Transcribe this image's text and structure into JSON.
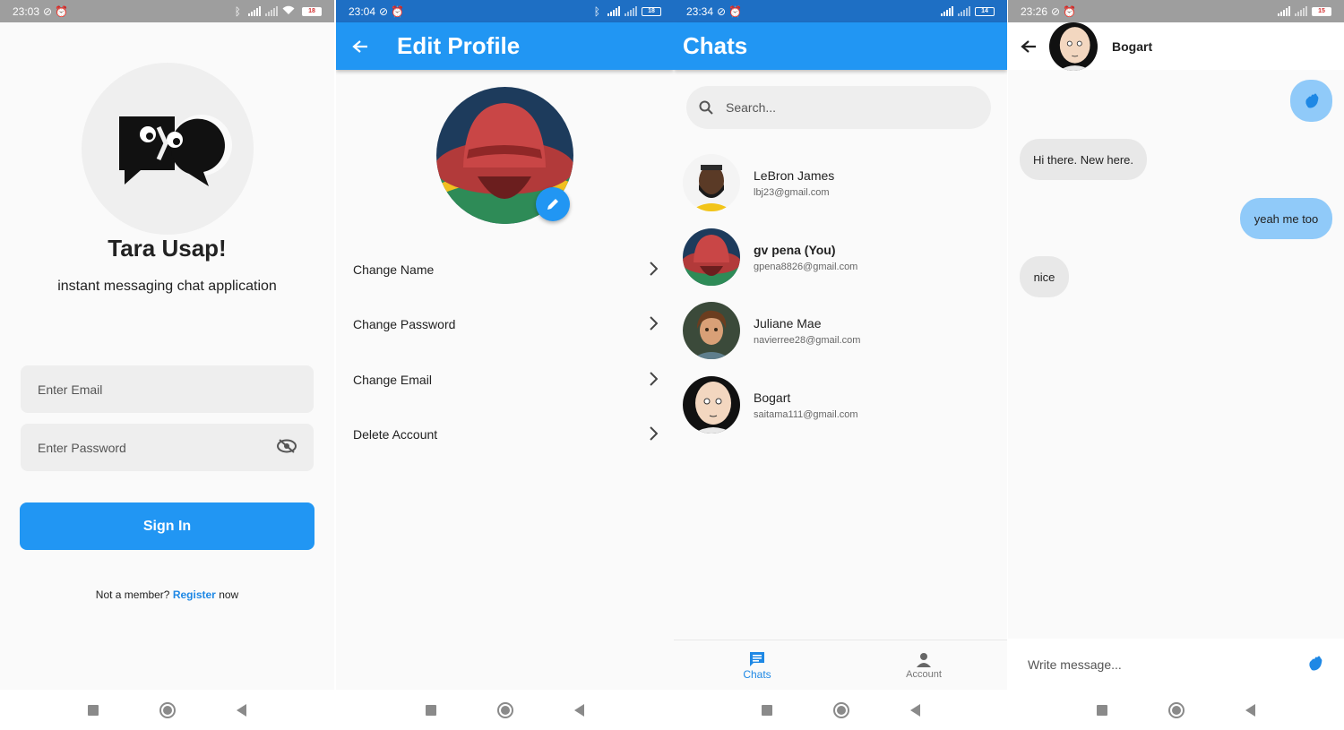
{
  "colors": {
    "primary": "#2196f3",
    "link": "#1e88e5",
    "outgoing_bubble": "#90caf9",
    "incoming_bubble": "#e8e8e8",
    "status_grey": "#9e9e9e",
    "status_blue": "#1e6fc4"
  },
  "screens": {
    "login": {
      "status": {
        "time": "23:03",
        "battery": "18"
      },
      "logo_icon": "chat-bubbles-logo-icon",
      "title": "Tara Usap!",
      "subtitle": "instant messaging chat application",
      "email_placeholder": "Enter Email",
      "password_placeholder": "Enter Password",
      "password_toggle_icon": "visibility-off-icon",
      "sign_in_label": "Sign In",
      "register_prefix": "Not a member?",
      "register_link": "Register",
      "register_suffix": "now"
    },
    "edit_profile": {
      "status": {
        "time": "23:04",
        "battery": "18"
      },
      "title": "Edit Profile",
      "back_icon": "arrow-back-icon",
      "edit_icon": "pencil-icon",
      "menu": [
        {
          "label": "Change Name"
        },
        {
          "label": "Change Password"
        },
        {
          "label": "Change Email"
        },
        {
          "label": "Delete Account"
        }
      ]
    },
    "chats": {
      "status": {
        "time": "23:34",
        "battery": "14"
      },
      "title": "Chats",
      "search_placeholder": "Search...",
      "contacts": [
        {
          "name": "LeBron James",
          "email": "lbj23@gmail.com",
          "avatar": "lebron-avatar"
        },
        {
          "name": "gv pena (You)",
          "email": "gpena8826@gmail.com",
          "avatar": "red-hat-avatar"
        },
        {
          "name": "Juliane Mae",
          "email": "navierree28@gmail.com",
          "avatar": "cartoon-prince-avatar"
        },
        {
          "name": "Bogart",
          "email": "saitama111@gmail.com",
          "avatar": "bald-hero-avatar"
        }
      ],
      "bottom_nav": [
        {
          "label": "Chats",
          "icon": "chat-icon",
          "active": true
        },
        {
          "label": "Account",
          "icon": "person-icon",
          "active": false
        }
      ]
    },
    "conversation": {
      "status": {
        "time": "23:26",
        "battery": "15"
      },
      "contact_name": "Bogart",
      "messages": [
        {
          "from": "me",
          "type": "emoji",
          "icon": "waving-hand-icon"
        },
        {
          "from": "them",
          "text": "Hi there. New here."
        },
        {
          "from": "me",
          "text": "yeah me too"
        },
        {
          "from": "them",
          "text": "nice"
        }
      ],
      "composer_placeholder": "Write message...",
      "send_icon": "waving-hand-icon"
    }
  }
}
